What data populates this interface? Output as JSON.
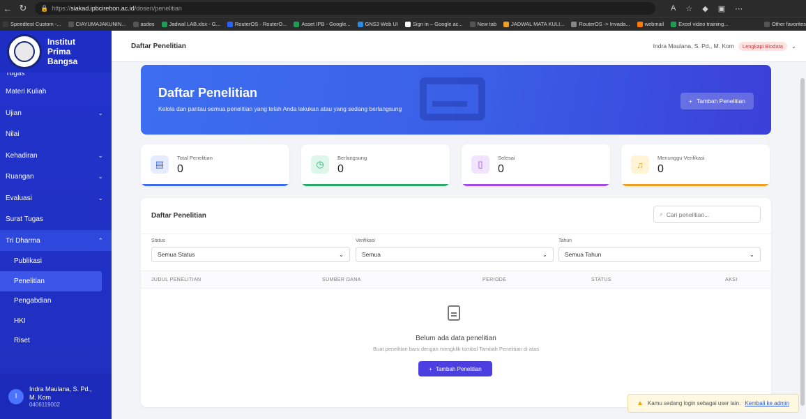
{
  "browser": {
    "url_prefix": "https://",
    "url_host": "siakad.ipbcirebon.ac.id",
    "url_path": "/dosen/penelitian",
    "bookmarks": [
      {
        "label": "Speedtest Custom -...",
        "color": "#3a3a3a"
      },
      {
        "label": "CIAYUMAJAKUNIN...",
        "color": "#555"
      },
      {
        "label": "asdos",
        "color": "#555"
      },
      {
        "label": "Jadwal LAB.xlsx - G...",
        "color": "#1f9d55"
      },
      {
        "label": "RouterOS - RouterO...",
        "color": "#2962ff"
      },
      {
        "label": "Asset IPB - Google...",
        "color": "#1f9d55"
      },
      {
        "label": "GNS3 Web UI",
        "color": "#2b8be0"
      },
      {
        "label": "Sign in – Google ac...",
        "color": "#ffffff"
      },
      {
        "label": "New tab",
        "color": "#555"
      },
      {
        "label": "JADWAL MATA KULI...",
        "color": "#f0a020"
      },
      {
        "label": "RouterOS -> Invada...",
        "color": "#888"
      },
      {
        "label": "webmail",
        "color": "#ff7a00"
      },
      {
        "label": "Excel video training...",
        "color": "#1f9d55"
      },
      {
        "label": "Other favorites",
        "color": "#555"
      }
    ]
  },
  "sidebar": {
    "brand_line1": "Institut",
    "brand_line2": "Prima",
    "brand_line3": "Bangsa",
    "cut_item": "Tugas",
    "items": [
      {
        "label": "Materi Kuliah",
        "chevron": ""
      },
      {
        "label": "Ujian",
        "chevron": "⌄"
      },
      {
        "label": "Nilai",
        "chevron": ""
      },
      {
        "label": "Kehadiran",
        "chevron": "⌄"
      },
      {
        "label": "Ruangan",
        "chevron": "⌄"
      },
      {
        "label": "Evaluasi",
        "chevron": "⌄"
      },
      {
        "label": "Surat Tugas",
        "chevron": ""
      },
      {
        "label": "Tri Dharma",
        "chevron": "⌃"
      }
    ],
    "sub_items": [
      "Publikasi",
      "Penelitian",
      "Pengabdian",
      "HKI",
      "Riset"
    ],
    "user": {
      "initial": "I",
      "name_line1": "Indra Maulana, S. Pd.,",
      "name_line2": "M. Kom",
      "id": "0406119002"
    }
  },
  "topbar": {
    "title": "Daftar Penelitian",
    "user": "Indra Maulana, S. Pd., M. Kom",
    "badge": "Lengkapi Biodata"
  },
  "hero": {
    "title": "Daftar Penelitian",
    "subtitle": "Kelola dan pantau semua penelitian yang telah Anda lakukan atau yang sedang berlangsung",
    "button": "Tambah Penelitian"
  },
  "stats": [
    {
      "label": "Total Penelitian",
      "value": "0",
      "color": "#3b6cf0",
      "bg": "#e6ecff",
      "icon": "▤"
    },
    {
      "label": "Berlangsung",
      "value": "0",
      "color": "#2aa86b",
      "bg": "#dff6ea",
      "icon": "◷"
    },
    {
      "label": "Selesai",
      "value": "0",
      "color": "#a24ae8",
      "bg": "#f1e4ff",
      "icon": "▯"
    },
    {
      "label": "Menunggu Verifikasi",
      "value": "0",
      "color": "#f0a020",
      "bg": "#fff4d6",
      "icon": "♫"
    }
  ],
  "list": {
    "title": "Daftar Penelitian",
    "search_placeholder": "Cari penelitian...",
    "filters": [
      {
        "label": "Status",
        "value": "Semua Status"
      },
      {
        "label": "Verifikasi",
        "value": "Semua"
      },
      {
        "label": "Tahun",
        "value": "Semua Tahun"
      }
    ],
    "columns": [
      "JUDUL PENELITIAN",
      "SUMBER DANA",
      "PERIODE",
      "STATUS",
      "AKSI"
    ],
    "empty_title": "Belum ada data penelitian",
    "empty_sub": "Buat penelitian baru dengan mengklik tombol Tambah Penelitian di atas",
    "empty_button": "Tambah Penelitian"
  },
  "toast": {
    "text": "Kamu sedang login sebagai user lain.",
    "link": "Kembali ke admin"
  }
}
